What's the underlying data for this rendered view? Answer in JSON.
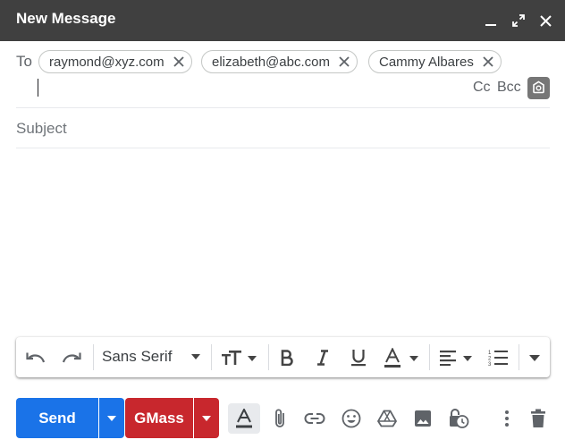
{
  "window": {
    "title": "New Message",
    "controls": [
      "minimize-icon",
      "expand-icon",
      "close-icon"
    ]
  },
  "recipients": {
    "label": "To",
    "chips": [
      "raymond@xyz.com",
      "elizabeth@abc.com",
      "Cammy Albares"
    ],
    "cc_label": "Cc",
    "bcc_label": "Bcc"
  },
  "subject": {
    "placeholder": "Subject"
  },
  "formatting": {
    "font": "Sans Serif",
    "icons": [
      "undo-icon",
      "redo-icon",
      "font-dropdown-icon",
      "text-size-icon",
      "bold-icon",
      "italic-icon",
      "underline-icon",
      "text-color-icon",
      "align-icon",
      "numbered-list-icon",
      "more-formatting-icon"
    ]
  },
  "bottom_bar": {
    "send_label": "Send",
    "gmass_label": "GMass",
    "icons": [
      "formatting-toggle-icon",
      "attach-icon",
      "link-icon",
      "emoji-icon",
      "drive-icon",
      "photo-icon",
      "schedule-icon",
      "more-options-icon",
      "trash-icon"
    ]
  },
  "colors": {
    "titlebar": "#404040",
    "send": "#1a73e8",
    "gmass": "#c8272d"
  }
}
